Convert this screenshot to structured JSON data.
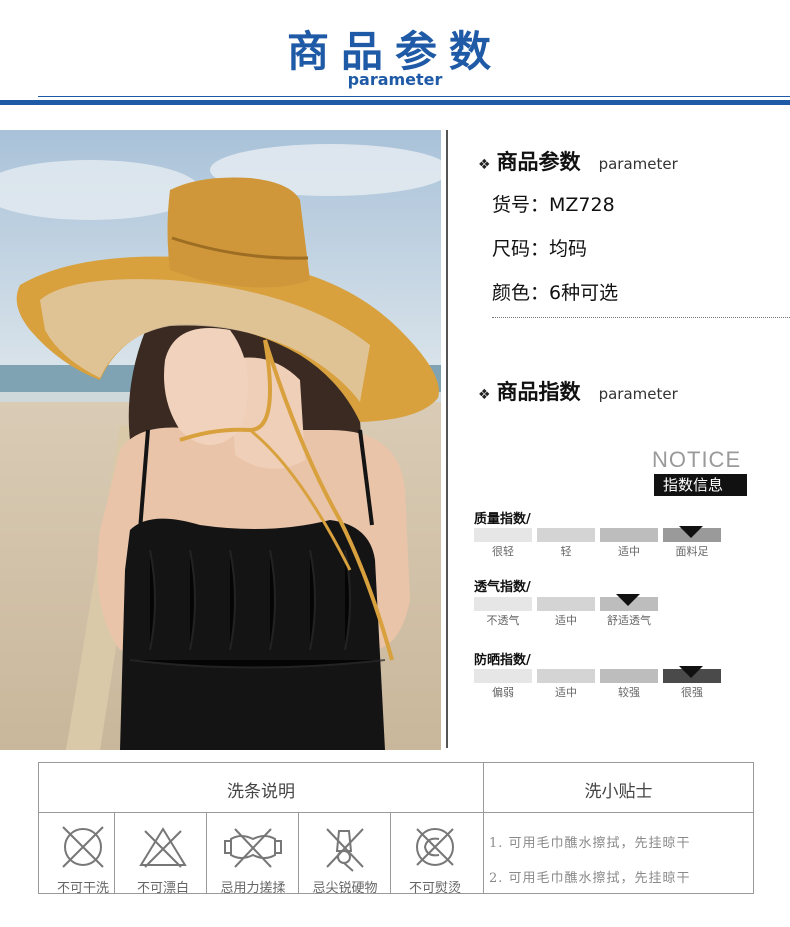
{
  "header": {
    "title": "商品参数",
    "subtitle": "parameter"
  },
  "params": {
    "heading": "商品参数",
    "heading_en": "parameter",
    "sku": "货号：MZ728",
    "size": "尺码：均码",
    "color": "颜色：6种可选"
  },
  "indices": {
    "heading": "商品指数",
    "heading_en": "parameter",
    "notice_en": "NOTICE",
    "notice_cn": "指数信息",
    "quality": {
      "label": "质量指数/",
      "levels": [
        "很轻",
        "轻",
        "适中",
        "面料足"
      ],
      "selected": "面料足"
    },
    "breath": {
      "label": "透气指数/",
      "levels": [
        "不透气",
        "适中",
        "舒适透气"
      ],
      "selected": "舒适透气"
    },
    "sun": {
      "label": "防晒指数/",
      "levels": [
        "偏弱",
        "适中",
        "较强",
        "很强"
      ],
      "selected": "很强"
    }
  },
  "care": {
    "wash_heading": "洗条说明",
    "tips_heading": "洗小贴士",
    "icons": [
      {
        "icon": "no-dry-clean-icon",
        "label": "不可干洗"
      },
      {
        "icon": "no-bleach-icon",
        "label": "不可漂白"
      },
      {
        "icon": "no-wring-icon",
        "label": "忌用力搓揉"
      },
      {
        "icon": "no-sharp-object-icon",
        "label": "忌尖锐硬物"
      },
      {
        "icon": "no-iron-icon",
        "label": "不可熨烫"
      }
    ],
    "tips": [
      "1. 可用毛巾醮水擦拭，先挂晾干",
      "2. 可用毛巾醮水擦拭，先挂晾干"
    ]
  },
  "colors": {
    "brand_blue": "#1f5aa6",
    "hat_mustard": "#d8a13e"
  }
}
